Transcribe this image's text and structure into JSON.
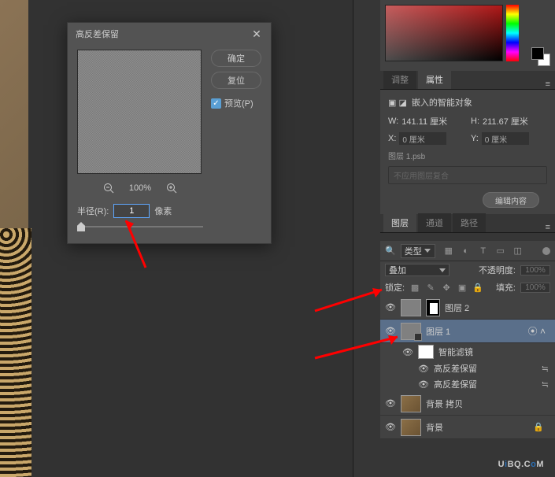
{
  "dialog": {
    "title": "高反差保留",
    "ok": "确定",
    "reset": "复位",
    "preview": "预览(P)",
    "zoom": "100%",
    "radius_label": "半径(R):",
    "radius_value": "1",
    "radius_unit": "像素"
  },
  "tabs_top": {
    "adjust": "调整",
    "props": "属性"
  },
  "props": {
    "title": "嵌入的智能对象",
    "w_label": "W:",
    "w_val": "141.11 厘米",
    "h_label": "H:",
    "h_val": "211.67 厘米",
    "x_label": "X:",
    "x_val": "0 厘米",
    "y_label": "Y:",
    "y_val": "0 厘米",
    "sub": "图层 1.psb",
    "disabled": "不应用图层复合",
    "edit": "编辑内容"
  },
  "tabs_layers": {
    "layers": "图层",
    "channels": "通道",
    "paths": "路径"
  },
  "layer_toolbar": {
    "search": "类型"
  },
  "blend": {
    "mode": "叠加",
    "opacity_label": "不透明度:",
    "opacity_val": "100%"
  },
  "lock": {
    "label": "锁定:",
    "fill_label": "填充:",
    "fill_val": "100%"
  },
  "layers": {
    "l2": "图层 2",
    "l1": "图层 1",
    "smartfilter": "智能滤镜",
    "hp1": "高反差保留",
    "hp2": "高反差保留",
    "bgcopy": "背景 拷贝",
    "bg": "背景"
  },
  "watermark": {
    "a": "U",
    "b": "i",
    "c": "BQ.C",
    "d": "o",
    "e": "M"
  }
}
